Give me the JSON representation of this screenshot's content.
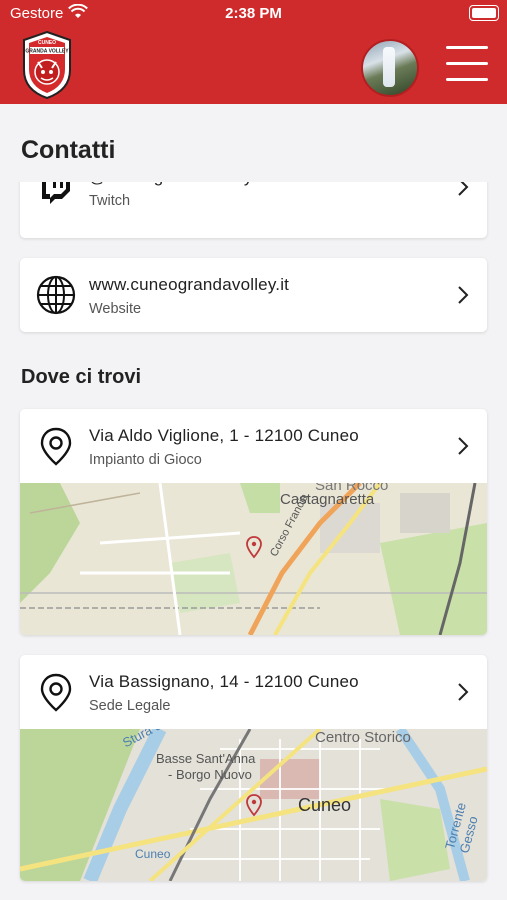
{
  "status_bar": {
    "carrier": "Gestore",
    "time": "2:38 PM"
  },
  "header": {
    "logo_text": "CUNEO GRANDA VOLLEY",
    "menu_icon": "hamburger-icon",
    "avatar_icon": "user-avatar"
  },
  "page": {
    "title": "Contatti"
  },
  "contacts": [
    {
      "primary": "@cuneograndavolley",
      "secondary": "Twitch",
      "icon": "twitch-icon"
    },
    {
      "primary": "www.cuneograndavolley.it",
      "secondary": "Website",
      "icon": "globe-icon"
    }
  ],
  "locations_section": {
    "title": "Dove ci trovi"
  },
  "locations": [
    {
      "address": "Via Aldo Viglione, 1 - 12100 Cuneo",
      "label": "Impianto di Gioco",
      "icon": "location-pin-icon",
      "map_labels": [
        "San Rocco",
        "Castagnaretta",
        "Corso Francia"
      ]
    },
    {
      "address": "Via Bassignano, 14 - 12100 Cuneo",
      "label": "Sede Legale",
      "icon": "location-pin-icon",
      "map_labels": [
        "Centro Storico",
        "Stura di De",
        "Basse Sant'Anna",
        "- Borgo Nuovo",
        "Cuneo",
        "Torrente Gesso",
        "Cuneo"
      ]
    }
  ],
  "colors": {
    "brand_red": "#cf2b2c",
    "background": "#f3f3f5",
    "card": "#ffffff",
    "text": "#222222"
  }
}
